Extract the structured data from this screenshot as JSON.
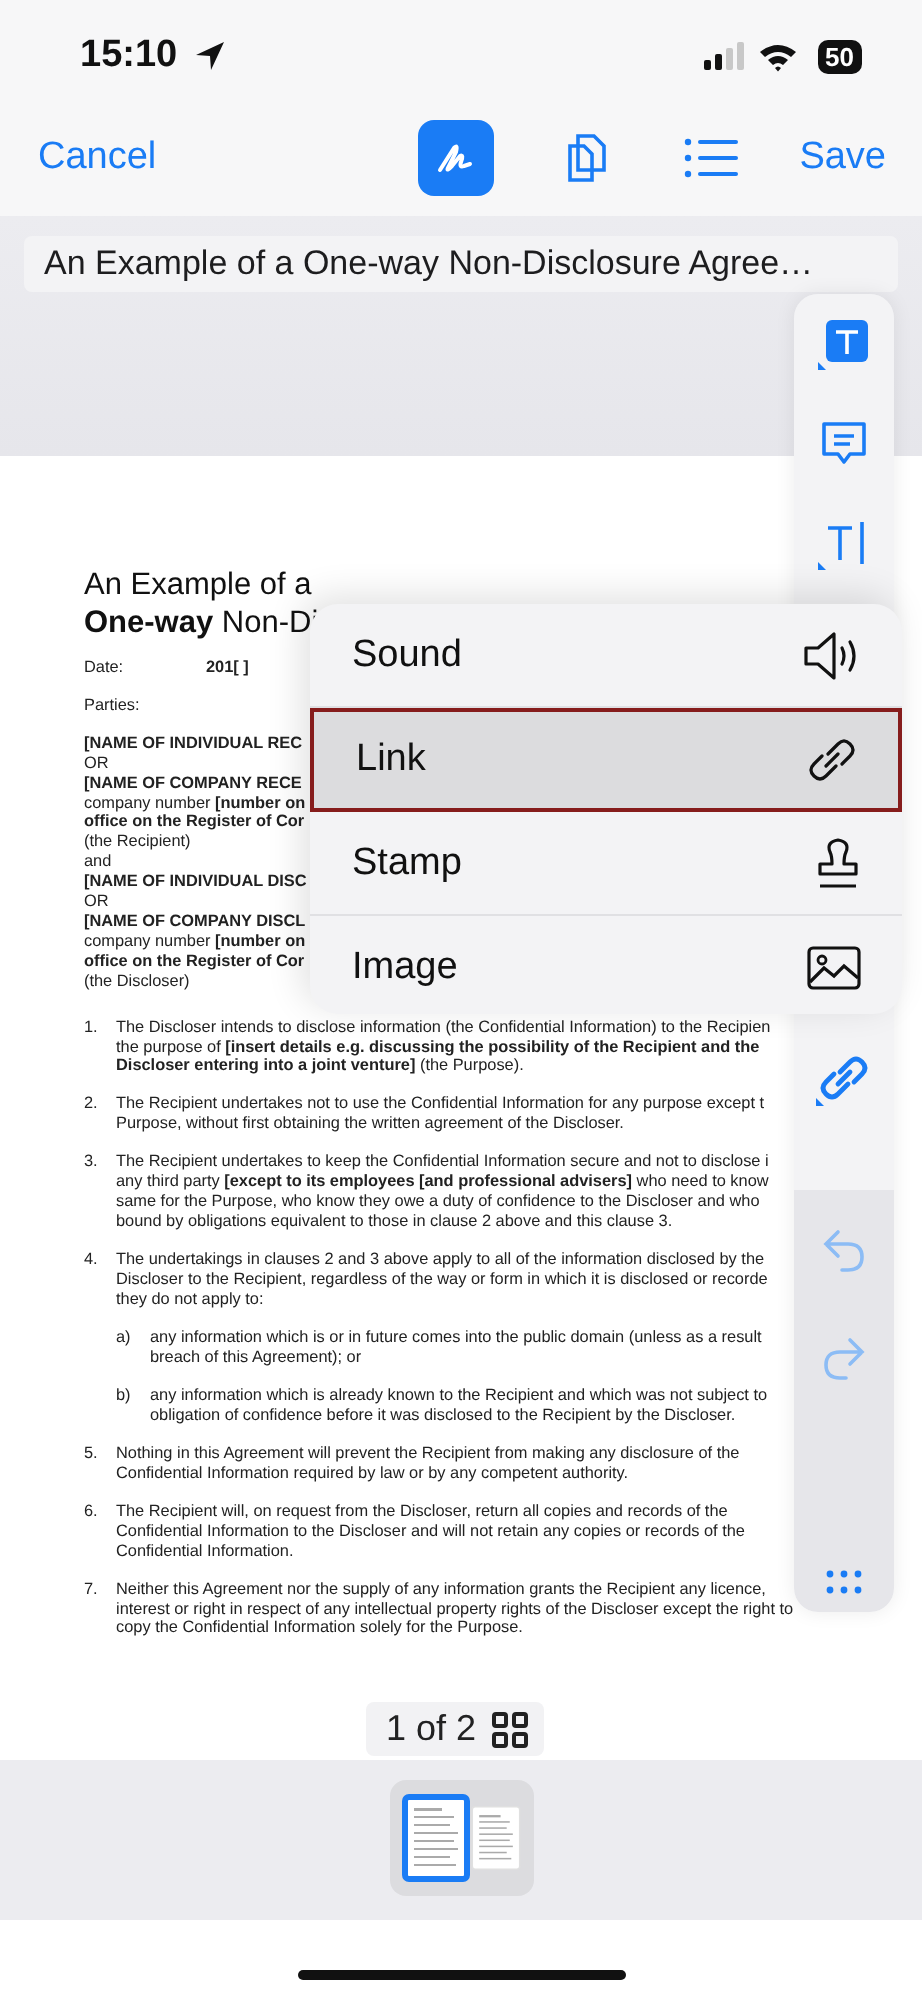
{
  "status_bar": {
    "time": "15:10",
    "battery": "50"
  },
  "nav_bar": {
    "cancel": "Cancel",
    "save": "Save",
    "tools": [
      {
        "kind": "markup",
        "selected": true
      },
      {
        "kind": "pages",
        "selected": false
      },
      {
        "kind": "outline",
        "selected": false
      }
    ]
  },
  "document_title": "An Example of a One-way Non-Disclosure Agree…",
  "document": {
    "title_lines": [
      "An Example of a",
      "**One-way** Non-Di"
    ],
    "date_label": "Date:",
    "date_value": "201[ ]",
    "parties_label": "Parties:",
    "party_lines": [
      {
        "text": "[NAME OF INDIVIDUAL REC",
        "bold": true
      },
      {
        "text": "OR",
        "bold": false
      },
      {
        "text": "[NAME OF COMPANY RECE",
        "bold": true
      },
      {
        "text": "company number **[number on**",
        "bold": false
      },
      {
        "text": "office on the Register of Cor",
        "bold": true
      },
      {
        "text": "(the Recipient)",
        "bold": false
      },
      {
        "text": "and",
        "bold": false
      },
      {
        "text": "[NAME OF INDIVIDUAL DISC",
        "bold": true
      },
      {
        "text": "OR",
        "bold": false
      },
      {
        "text": "[NAME OF COMPANY DISCL",
        "bold": true
      },
      {
        "text": "company number **[number on**",
        "bold": false
      },
      {
        "text": "office on the Register of Cor",
        "bold": true
      },
      {
        "text": "(the Discloser)",
        "bold": false
      }
    ],
    "clauses": [
      {
        "number": "1.",
        "lines": [
          "The Discloser intends to disclose information (the Confidential Information) to the Recipien",
          "the purpose of **[insert details e.g. discussing the possibility of the Recipient and the**",
          "**Discloser entering into a joint venture]** (the Purpose)."
        ]
      },
      {
        "number": "2.",
        "lines": [
          "The Recipient undertakes not to use the Confidential Information for any purpose except t",
          "Purpose, without first obtaining the written agreement of the Discloser."
        ]
      },
      {
        "number": "3.",
        "lines": [
          "The Recipient undertakes to keep the Confidential Information secure and not to disclose i",
          "any third party **[except to its employees [and professional advisers]** who need to know",
          "same for the Purpose, who know they owe a duty of confidence to the Discloser and who",
          "bound by obligations equivalent to those in clause 2 above and this clause 3."
        ]
      },
      {
        "number": "4.",
        "lines": [
          "The undertakings in clauses 2 and 3 above apply to all of the information disclosed by the",
          "Discloser to the Recipient, regardless of the way or form in which it is disclosed or recorde",
          "they do not apply to:"
        ],
        "children": [
          {
            "number": "a)",
            "lines": [
              "any information which is or in future comes into the public domain (unless as a result",
              "breach of this Agreement); or"
            ]
          },
          {
            "number": "b)",
            "lines": [
              "any information which is already known to the Recipient and which was not subject to",
              "obligation of confidence before it was disclosed to the Recipient by the Discloser."
            ]
          }
        ]
      },
      {
        "number": "5.",
        "lines": [
          "Nothing in this Agreement will prevent the Recipient from making any disclosure of the",
          "Confidential Information required by law or by any competent authority."
        ]
      },
      {
        "number": "6.",
        "lines": [
          "The Recipient will, on request from the Discloser, return all copies and records of the",
          "Confidential Information to the Discloser and will not retain any copies or records of the",
          "Confidential Information."
        ]
      },
      {
        "number": "7.",
        "lines": [
          "Neither this Agreement nor the supply of any information grants the Recipient any licence,",
          "interest or right in respect of any intellectual property rights of the Discloser except the right to",
          "copy the Confidential Information solely for the Purpose."
        ]
      }
    ]
  },
  "side_toolbar": {
    "tools": [
      {
        "kind": "text-box",
        "selected": true
      },
      {
        "kind": "comment",
        "selected": false
      },
      {
        "kind": "text-cursor",
        "selected": false
      },
      {
        "kind": "link",
        "selected": false
      }
    ],
    "actions": [
      {
        "kind": "undo"
      },
      {
        "kind": "redo"
      },
      {
        "kind": "more"
      }
    ]
  },
  "menu": [
    {
      "label": "Sound",
      "kind": "sound",
      "selected": false
    },
    {
      "label": "Link",
      "kind": "link",
      "selected": true
    },
    {
      "label": "Stamp",
      "kind": "stamp",
      "selected": false
    },
    {
      "label": "Image",
      "kind": "image",
      "selected": false
    }
  ],
  "page_indicator": "1 of 2",
  "thumbnails": [
    {
      "selected": true
    },
    {
      "selected": false
    }
  ]
}
